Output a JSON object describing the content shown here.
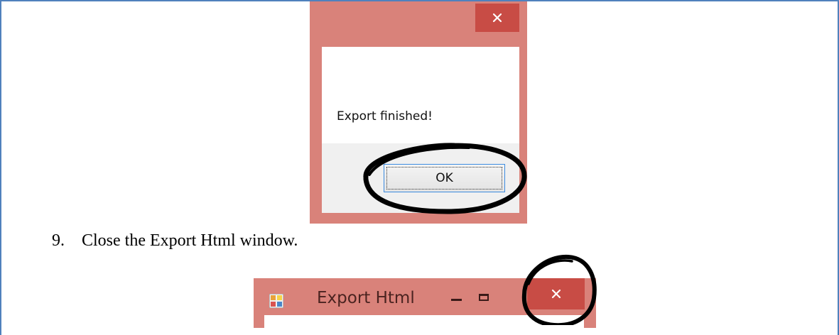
{
  "message_box": {
    "close_icon": "close-icon",
    "message": "Export finished!",
    "ok_label": "OK"
  },
  "instruction": {
    "number": "9.",
    "text": "Close the Export Html window."
  },
  "export_window": {
    "app_icon": "app-window-icon",
    "title": "Export Html",
    "minimize_icon": "minimize-icon",
    "maximize_icon": "maximize-icon",
    "close_icon": "close-icon"
  },
  "colors": {
    "frame_border": "#4f81bd",
    "window_frame": "#d9827a",
    "close_button": "#c84c45",
    "annotation": "#000000"
  }
}
